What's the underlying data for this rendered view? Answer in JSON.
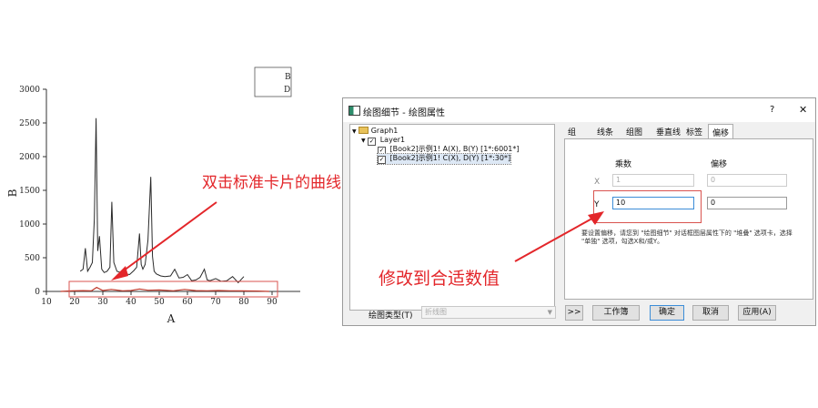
{
  "chart_data": {
    "type": "line",
    "xlabel": "A",
    "ylabel": "B",
    "xlim": [
      10,
      100
    ],
    "ylim": [
      0,
      3000
    ],
    "x_ticks": [
      10,
      20,
      30,
      40,
      50,
      60,
      70,
      80,
      90
    ],
    "y_ticks": [
      0,
      500,
      1000,
      1500,
      2000,
      2500,
      3000
    ],
    "legend": [
      "B",
      "D"
    ],
    "legend_position": "top-right",
    "series": [
      {
        "name": "B",
        "x": [
          22,
          23,
          23.8,
          24.6,
          25.5,
          26.3,
          27,
          27.6,
          28.2,
          28.8,
          29.6,
          30.5,
          31.5,
          32.5,
          33.2,
          33.9,
          35,
          36.5,
          38,
          39.5,
          41,
          42,
          43,
          43.6,
          44.2,
          45,
          46,
          47,
          47.6,
          48.2,
          49,
          50.5,
          52,
          54,
          55.5,
          57,
          58.5,
          60,
          61.5,
          63,
          64.5,
          66,
          67,
          68,
          70,
          72,
          74,
          76,
          78,
          80
        ],
        "values": [
          300,
          330,
          640,
          300,
          360,
          430,
          1080,
          2570,
          600,
          820,
          330,
          280,
          300,
          360,
          1330,
          430,
          300,
          280,
          260,
          250,
          310,
          360,
          860,
          400,
          330,
          400,
          760,
          1700,
          520,
          300,
          260,
          230,
          220,
          230,
          330,
          200,
          210,
          250,
          160,
          170,
          210,
          330,
          170,
          160,
          190,
          150,
          160,
          220,
          130,
          220
        ]
      },
      {
        "name": "D",
        "x": [
          15,
          19,
          23,
          26,
          27.8,
          30,
          33,
          37,
          40,
          43,
          46,
          50,
          55,
          59,
          63,
          67,
          71,
          75,
          79,
          85,
          89
        ],
        "values": [
          0,
          8,
          12,
          10,
          60,
          14,
          30,
          10,
          14,
          36,
          18,
          22,
          10,
          30,
          12,
          10,
          14,
          10,
          8,
          6,
          0
        ]
      }
    ]
  },
  "annotations": {
    "top": "双击标准卡片的曲线",
    "bottom": "修改到合适数值"
  },
  "dialog": {
    "title": "绘图细节 - 绘图属性",
    "help_label": "?",
    "close_label": "✕",
    "tree": {
      "root": "Graph1",
      "layer": "Layer1",
      "plot1": "[Book2]示例1! A(X), B(Y) [1*:6001*]",
      "plot2": "[Book2]示例1! C(X), D(Y) [1*:30*]"
    },
    "tabs": [
      "组",
      "线条",
      "组图",
      "垂直线",
      "标签",
      "偏移"
    ],
    "panel": {
      "col1": "乘数",
      "col2": "偏移",
      "x_label": "X",
      "y_label": "Y",
      "x_mult": "1",
      "x_offset": "0",
      "y_mult": "10",
      "y_offset": "0",
      "note": "要设置偏移，请您到 \"绘图细节\" 对话框图层属性下的 \"堆叠\" 选项卡，选择 \"单独\" 选项，勾选X和/或Y。"
    },
    "plot_type_label": "绘图类型(T)",
    "plot_type_value": "折线图",
    "buttons": {
      "more": ">>",
      "workbook": "工作簿",
      "ok": "确定",
      "cancel": "取消",
      "apply": "应用(A)"
    }
  },
  "colors": {
    "annotation_red": "#e3262a",
    "highlight_box": "#d9534f",
    "selection_blue": "#3c8dd8"
  }
}
